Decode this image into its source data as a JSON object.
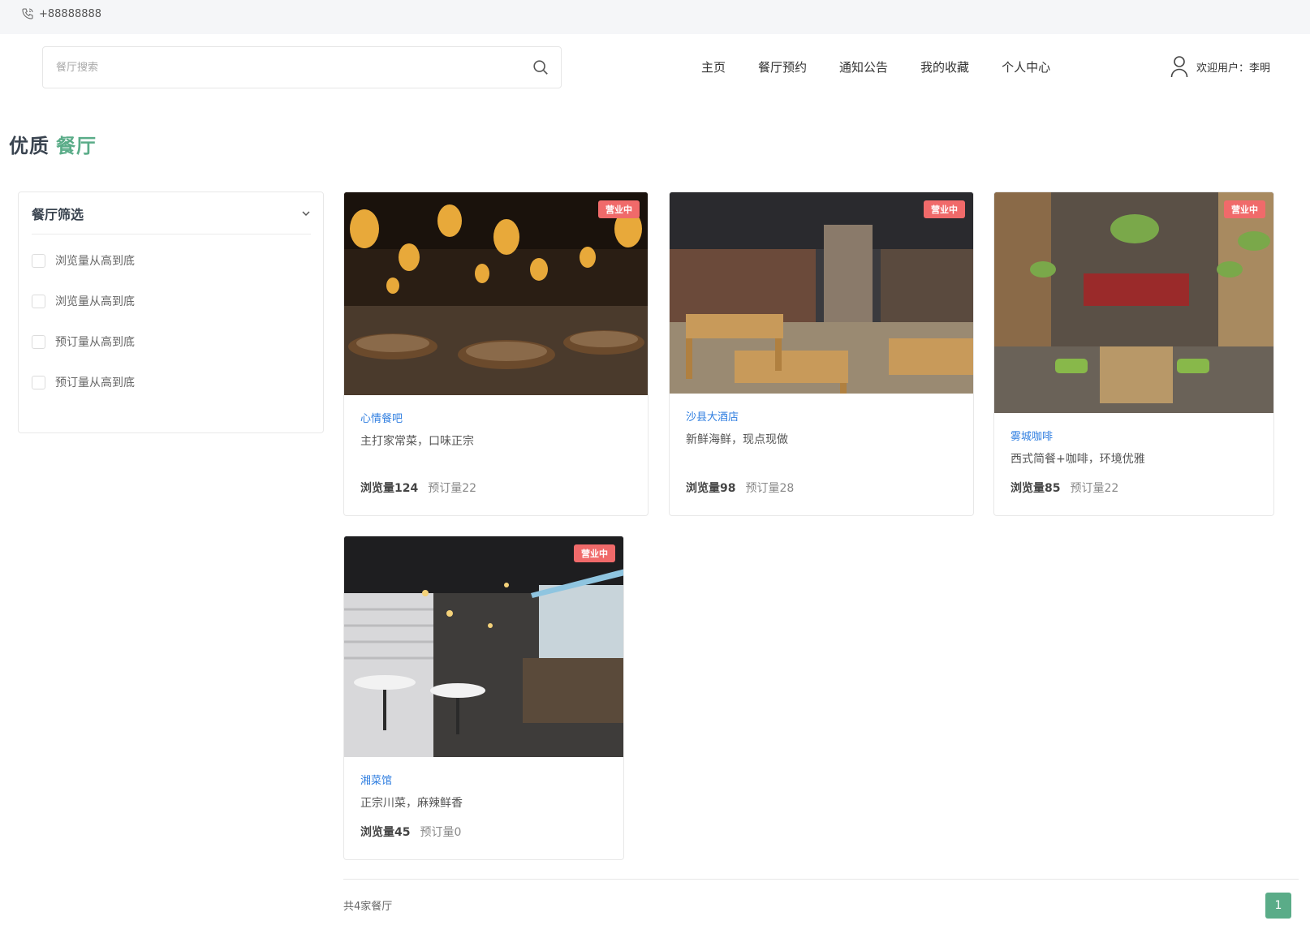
{
  "topbar": {
    "phone": "+88888888"
  },
  "search": {
    "placeholder": "餐厅搜索"
  },
  "nav": {
    "items": [
      "主页",
      "餐厅预约",
      "通知公告",
      "我的收藏",
      "个人中心"
    ]
  },
  "user": {
    "welcome": "欢迎用户：李明"
  },
  "section": {
    "title_main": "优质",
    "title_accent": "餐厅"
  },
  "filter": {
    "title": "餐厅筛选",
    "options": [
      "浏览量从高到底",
      "浏览量从高到底",
      "预订量从高到底",
      "预订量从高到底"
    ]
  },
  "restaurants": [
    {
      "badge": "营业中",
      "name": "心情餐吧",
      "desc": "主打家常菜，口味正宗",
      "views": "浏览量124",
      "orders": "预订量22"
    },
    {
      "badge": "营业中",
      "name": "沙县大酒店",
      "desc": "新鲜海鲜，现点现做",
      "views": "浏览量98",
      "orders": "预订量28"
    },
    {
      "badge": "营业中",
      "name": "雾城咖啡",
      "desc": "西式简餐+咖啡，环境优雅",
      "views": "浏览量85",
      "orders": "预订量22"
    },
    {
      "badge": "营业中",
      "name": "湘菜馆",
      "desc": "正宗川菜，麻辣鲜香",
      "views": "浏览量45",
      "orders": "预订量0"
    }
  ],
  "pagination": {
    "total": "共4家餐厅",
    "current": "1"
  },
  "colors": {
    "accent": "#5aac88",
    "badge": "#f06a6a",
    "link": "#2f7ee0"
  }
}
